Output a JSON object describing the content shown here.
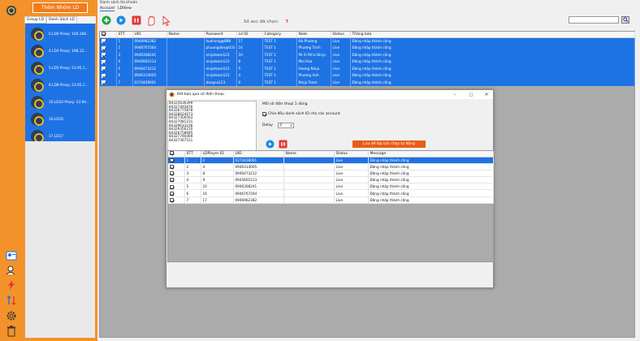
{
  "sidebar": {
    "add_button_label": "Thêm Nhóm LD",
    "tabs": [
      "Group LD",
      "Danh Sách LD"
    ],
    "items": [
      {
        "label": "0.LD0 Proxy: 104.168..."
      },
      {
        "label": "4.LD4 Proxy: 198.12..."
      },
      {
        "label": "5.LD5 Proxy: 23.95.1..."
      },
      {
        "label": "8.LD8 Proxy: 23.95.1..."
      },
      {
        "label": "10.LD10 Proxy: 23.94..."
      },
      {
        "label": "16.LD16"
      },
      {
        "label": "17.LD17"
      }
    ]
  },
  "main": {
    "title": "Danh sách tài khoản",
    "tabs": [
      "Account",
      "LDView"
    ],
    "selected_label": "Số acc đã chọn:",
    "selected_count": "7",
    "account_table": {
      "headers": [
        "",
        "STT",
        "UID",
        "Name",
        "Password",
        "Ld ID",
        "Category",
        "Note",
        "Status",
        "Thông báo"
      ],
      "rows": [
        {
          "checked": true,
          "cells": [
            "1",
            "0946962382",
            "",
            "hoahong@888",
            "17",
            "TEST 1",
            "Hà Phương",
            "Live",
            "Đăng nhập thành công"
          ]
        },
        {
          "checked": true,
          "cells": [
            "2",
            "0946767264",
            "",
            "phuongahn@031",
            "16",
            "TEST 1",
            "Phương Trinh",
            "Live",
            "Đăng nhập thành công"
          ]
        },
        {
          "checked": true,
          "cells": [
            "3",
            "0946308241",
            "",
            "ninjateam123",
            "10",
            "TEST 1",
            "Pé Xi Mi'ai Ninja",
            "Live",
            "Đăng nhập thành công"
          ]
        },
        {
          "checked": true,
          "cells": [
            "4",
            "0945661513",
            "",
            "ninjateam123",
            "8",
            "TEST 1",
            "Mai Hoa",
            "Live",
            "Đăng nhập thành công"
          ]
        },
        {
          "checked": true,
          "cells": [
            "5",
            "0946473212",
            "",
            "ninjateam123",
            "5",
            "TEST 1",
            "Hương Ninja",
            "Live",
            "Đăng nhập thành công"
          ]
        },
        {
          "checked": true,
          "cells": [
            "6",
            "0946314005",
            "",
            "ninjateam123",
            "4",
            "TEST 1",
            "Phương Anh",
            "Live",
            "Đăng nhập thành công"
          ]
        },
        {
          "checked": true,
          "cells": [
            "7",
            "0374428061",
            "",
            "dangno123",
            "0",
            "TEST 1",
            "Ninja Team",
            "Live",
            "Đăng nhập thành công"
          ]
        }
      ]
    }
  },
  "dialog": {
    "title": "Kết bạn qua số điện thoại",
    "phones": [
      "84325636399",
      "84327493676",
      "84326775878",
      "84328624073",
      "84327356563",
      "84327081231",
      "84329633236",
      "84329356210",
      "84326758695",
      "84327746469",
      "84327367511"
    ],
    "option1": "Mỗi số điện thoại 1 dòng",
    "option2": "Chia đều danh sách ID cho các account",
    "delay_label": "Delay",
    "delay_value": "3",
    "save_button": "Lưu để lập lịch chạy tự động",
    "result_table": {
      "headers": [
        "",
        "STT",
        "LDPlayer ID",
        "UID",
        "Name",
        "Status",
        "Message"
      ],
      "rows": [
        {
          "checked": true,
          "cells": [
            "1",
            "0",
            "0374428061",
            "",
            "Live",
            "Đăng nhập thành công"
          ]
        },
        {
          "checked": true,
          "cells": [
            "2",
            "4",
            "0946314005",
            "",
            "Live",
            "Đăng nhập thành công"
          ]
        },
        {
          "checked": true,
          "cells": [
            "3",
            "8",
            "0946473212",
            "",
            "Live",
            "Đăng nhập thành công"
          ]
        },
        {
          "checked": true,
          "cells": [
            "4",
            "9",
            "0945661513",
            "",
            "Live",
            "Đăng nhập thành công"
          ]
        },
        {
          "checked": true,
          "cells": [
            "5",
            "10",
            "0946308241",
            "",
            "Live",
            "Đăng nhập thành công"
          ]
        },
        {
          "checked": true,
          "cells": [
            "6",
            "16",
            "0946767264",
            "",
            "Live",
            "Đăng nhập thành công"
          ]
        },
        {
          "checked": true,
          "cells": [
            "7",
            "17",
            "0946962382",
            "",
            "Live",
            "Đăng nhập thành công"
          ]
        }
      ]
    }
  },
  "colors": {
    "accent_orange": "#f3922a",
    "selection_blue": "#1e73e4",
    "count_red": "#e53935",
    "save_orange": "#e85d1a"
  },
  "icons": [
    "app-logo-icon",
    "add-icon",
    "play-icon",
    "stop-icon",
    "hand-icon",
    "cursor-icon",
    "search-icon",
    "settings-icon",
    "trash-icon"
  ]
}
